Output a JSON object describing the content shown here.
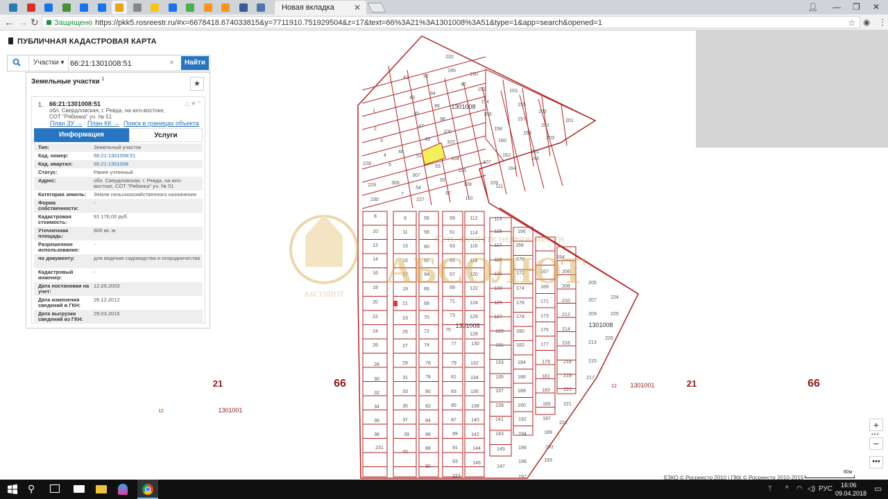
{
  "browser": {
    "active_tab_title": "Новая вкладка",
    "secure_label": "Защищено",
    "url": "https://pkk5.rosreestr.ru/#x=6678418.674033815&y=7711910.751929504&z=17&text=66%3A21%3A1301008%3A51&type=1&app=search&opened=1",
    "pinned_tab_icons": [
      "app-icon",
      "mail-icon",
      "settings-icon",
      "maps-icon",
      "browser-icon",
      "puzzle-icon",
      "chrome-icon",
      "cursor-icon",
      "star-icon",
      "map-pin-icon",
      "whatsapp-icon",
      "odnoklassniki-icon",
      "odnoklassniki-icon",
      "facebook-icon",
      "vk-icon"
    ],
    "pinned_tab_colors": [
      "#2a7ab0",
      "#d93025",
      "#1a73e8",
      "#4a8f3c",
      "#1a73e8",
      "#1a73e8",
      "#e8a317",
      "#888888",
      "#f5c518",
      "#1a73e8",
      "#4caf50",
      "#f7931e",
      "#f7931e",
      "#3b5998",
      "#4a76a8"
    ]
  },
  "app": {
    "title": "ПУБЛИЧНАЯ КАДАСТРОВАЯ КАРТА",
    "search": {
      "type_label": "Участки",
      "query": "66:21:1301008:51",
      "button": "Найти"
    },
    "panel": {
      "header": "Земельные участки",
      "count": "1",
      "result": {
        "index": "1.",
        "cad_number": "66:21:1301008:51",
        "address": "обл. Свердловская, г. Ревда, на юго-востоке, СОТ \"Рябинка\" уч. № 51",
        "links": [
          "План ЗУ →",
          "План КК →",
          "Поиск в границах объекта →"
        ],
        "tabs": [
          "Информация",
          "Услуги"
        ],
        "info": [
          {
            "key": "Тип:",
            "value": "Земельный участок",
            "link": false
          },
          {
            "key": "Кад. номер:",
            "value": "66:21:1301008:51",
            "link": true
          },
          {
            "key": "Кад. квартал:",
            "value": "66:21:1301008",
            "link": true
          },
          {
            "key": "Статус:",
            "value": "Ранее учтенный",
            "link": false
          },
          {
            "key": "Адрес:",
            "value": "обл. Свердловская, г. Ревда, на юго-востоке, СОТ \"Рябинка\" уч. № 51",
            "link": false
          },
          {
            "key": "Категория земель:",
            "value": "Земли сельскохозяйственного назначения",
            "link": false
          },
          {
            "key": "Форма собственности:",
            "value": "-",
            "link": false
          },
          {
            "key": "Кадастровая стоимость:",
            "value": "91 176,00 руб.",
            "link": false
          },
          {
            "key": "Уточненная площадь:",
            "value": "600 кв. м",
            "link": false
          },
          {
            "key": "Разрешенное использование:",
            "value": "-",
            "link": false
          },
          {
            "key": "по документу:",
            "value": "для ведения садоводства и огородничества",
            "link": false
          },
          {
            "key": "Кадастровый инженер:",
            "value": "-",
            "link": false
          },
          {
            "key": "Дата постановки на учет:",
            "value": "12.09.2003",
            "link": false
          },
          {
            "key": "Дата изменения сведений в ГКН:",
            "value": "26.12.2012",
            "link": false
          },
          {
            "key": "Дата выгрузки сведений из ГКН:",
            "value": "29.03.2015",
            "link": false
          }
        ]
      }
    }
  },
  "map": {
    "quarter_labels": [
      "1301008",
      "1301008",
      "1301008"
    ],
    "district_label": "21",
    "region_label": "66",
    "small_label": "12",
    "neighbor_quarter": "1301001",
    "selected_parcel": "51",
    "watermark_line1": "Сеть агентств недвижимости",
    "watermark_line2": "АБСОЛЮТ",
    "watermark_small": "АБСОЛЮТ",
    "parcel_color": "#b22222",
    "selected_color": "#f4ef5a",
    "attribution": "ЕЗКО © Росреестр 2010 | ПКК © Росреестр 2010-2015",
    "scale": "60м",
    "zoom_in": "+",
    "zoom_out": "−",
    "more": "•••"
  },
  "taskbar": {
    "lang": "РУС",
    "time": "16:06",
    "date": "09.04.2018"
  }
}
